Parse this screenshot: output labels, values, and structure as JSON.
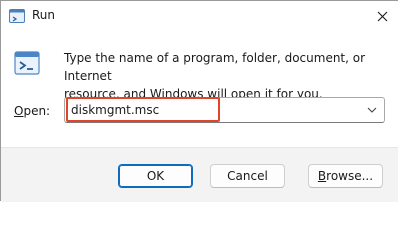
{
  "window": {
    "title": "Run",
    "close_glyph": "×"
  },
  "icons": {
    "title_icon": "run-icon",
    "body_icon": "run-icon",
    "close_icon": "close-icon",
    "dropdown_icon": "chevron-down-icon"
  },
  "prompt": {
    "line1": "Type the name of a program, folder, document, or Internet",
    "line2": "resource, and Windows will open it for you."
  },
  "open": {
    "label_mnemonic": "O",
    "label_rest": "pen:",
    "value": "diskmgmt.msc"
  },
  "buttons": {
    "ok": "OK",
    "cancel": "Cancel",
    "browse_mnemonic": "B",
    "browse_rest": "rowse..."
  },
  "colors": {
    "highlight_border": "#e1442a",
    "default_button_border": "#0f6cbd",
    "footer_background": "#f3f3f3"
  }
}
